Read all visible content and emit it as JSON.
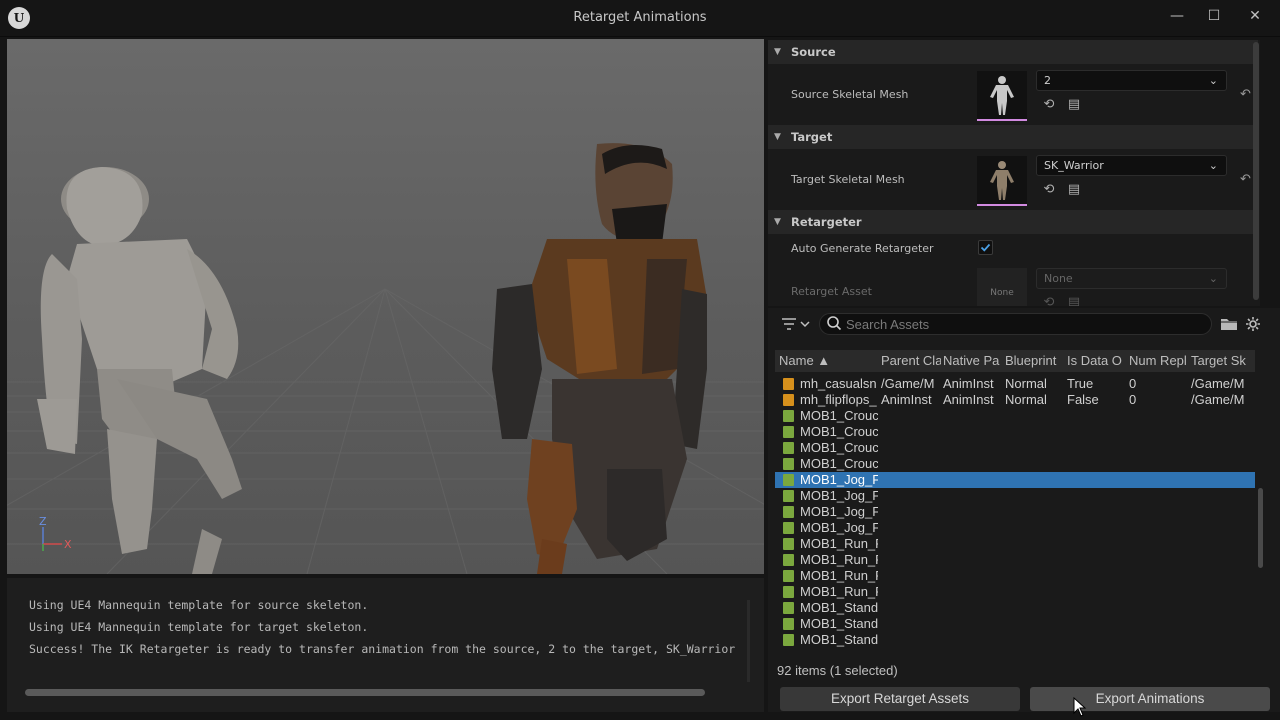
{
  "window": {
    "title": "Retarget Animations",
    "logo_text": "U",
    "minimize": "—",
    "maximize": "☐",
    "close": "✕"
  },
  "viewport": {
    "axis_z": "Z",
    "axis_x": "X"
  },
  "console": {
    "lines": [
      "Using UE4 Mannequin template for source skeleton.",
      "Using UE4 Mannequin template for target skeleton.",
      "Success! The IK Retargeter is ready to transfer animation from the source, 2 to the target, SK_Warrior"
    ]
  },
  "details": {
    "source": {
      "header": "Source",
      "label": "Source Skeletal Mesh",
      "value": "2"
    },
    "target": {
      "header": "Target",
      "label": "Target Skeletal Mesh",
      "value": "SK_Warrior"
    },
    "retargeter": {
      "header": "Retargeter",
      "auto_label": "Auto Generate Retargeter",
      "auto_checked": true,
      "asset_label": "Retarget Asset",
      "asset_thumb": "None",
      "asset_value": "None"
    }
  },
  "browser": {
    "search_placeholder": "Search Assets",
    "columns": [
      "Name ▲",
      "Parent Cla",
      "Native Pa",
      "Blueprint",
      "Is Data O",
      "Num Repl",
      "Target Sk"
    ],
    "rows": [
      {
        "type": "bp",
        "cells": [
          "mh_casualsn",
          "/Game/M",
          "AnimInst",
          "Normal",
          "True",
          "0",
          "/Game/M"
        ]
      },
      {
        "type": "bp",
        "cells": [
          "mh_flipflops_",
          "AnimInst",
          "AnimInst",
          "Normal",
          "False",
          "0",
          "/Game/M"
        ]
      },
      {
        "type": "an",
        "cells": [
          "MOB1_Croucl",
          "",
          "",
          "",
          "",
          "",
          ""
        ]
      },
      {
        "type": "an",
        "cells": [
          "MOB1_Croucl",
          "",
          "",
          "",
          "",
          "",
          ""
        ]
      },
      {
        "type": "an",
        "cells": [
          "MOB1_Croucl",
          "",
          "",
          "",
          "",
          "",
          ""
        ]
      },
      {
        "type": "an",
        "cells": [
          "MOB1_Croucl",
          "",
          "",
          "",
          "",
          "",
          ""
        ]
      },
      {
        "type": "an",
        "cells": [
          "MOB1_Jog_F",
          "",
          "",
          "",
          "",
          "",
          ""
        ],
        "selected": true
      },
      {
        "type": "an",
        "cells": [
          "MOB1_Jog_F",
          "",
          "",
          "",
          "",
          "",
          ""
        ]
      },
      {
        "type": "an",
        "cells": [
          "MOB1_Jog_F",
          "",
          "",
          "",
          "",
          "",
          ""
        ]
      },
      {
        "type": "an",
        "cells": [
          "MOB1_Jog_F",
          "",
          "",
          "",
          "",
          "",
          ""
        ]
      },
      {
        "type": "an",
        "cells": [
          "MOB1_Run_F",
          "",
          "",
          "",
          "",
          "",
          ""
        ]
      },
      {
        "type": "an",
        "cells": [
          "MOB1_Run_F",
          "",
          "",
          "",
          "",
          "",
          ""
        ]
      },
      {
        "type": "an",
        "cells": [
          "MOB1_Run_F",
          "",
          "",
          "",
          "",
          "",
          ""
        ]
      },
      {
        "type": "an",
        "cells": [
          "MOB1_Run_F",
          "",
          "",
          "",
          "",
          "",
          ""
        ]
      },
      {
        "type": "an",
        "cells": [
          "MOB1_Stand",
          "",
          "",
          "",
          "",
          "",
          ""
        ]
      },
      {
        "type": "an",
        "cells": [
          "MOB1_Stand",
          "",
          "",
          "",
          "",
          "",
          ""
        ]
      },
      {
        "type": "an",
        "cells": [
          "MOB1_Stand",
          "",
          "",
          "",
          "",
          "",
          ""
        ]
      }
    ],
    "count_text": "92 items (1 selected)",
    "export_retarget_label": "Export Retarget Assets",
    "export_animations_label": "Export Animations"
  }
}
